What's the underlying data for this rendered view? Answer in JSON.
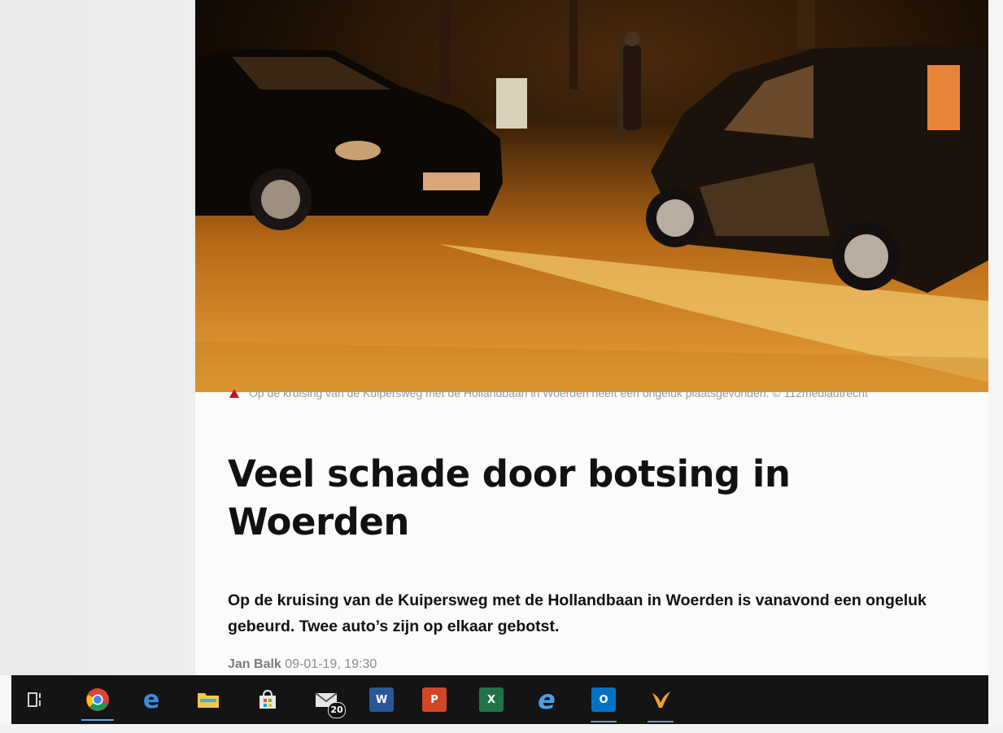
{
  "article": {
    "caption": "Op de kruising van de Kuipersweg met de Hollandbaan in Woerden heeft een ongeluk plaatsgevonden. © 112mediautrecht",
    "headline": "Veel schade door botsing in Woerden",
    "lead": "Op de kruising van de Kuipersweg met de Hollandbaan in Woerden is vanavond een ongeluk gebeurd. Twee auto’s zijn op elkaar gebotst.",
    "author": "Jan Balk",
    "timestamp": "09-01-19, 19:30"
  },
  "taskbar": {
    "items": [
      {
        "name": "task-view",
        "icon": "task-view-icon"
      },
      {
        "name": "chrome",
        "icon": "chrome-icon"
      },
      {
        "name": "edge",
        "icon": "edge-icon"
      },
      {
        "name": "file-explorer",
        "icon": "folder-icon"
      },
      {
        "name": "store",
        "icon": "store-icon"
      },
      {
        "name": "mail",
        "icon": "mail-icon",
        "badge": "20"
      },
      {
        "name": "word",
        "icon": "word-icon",
        "label": "W"
      },
      {
        "name": "powerpoint",
        "icon": "powerpoint-icon",
        "label": "P"
      },
      {
        "name": "excel",
        "icon": "excel-icon",
        "label": "X"
      },
      {
        "name": "internet-explorer",
        "icon": "ie-icon",
        "label": "e"
      },
      {
        "name": "outlook",
        "icon": "outlook-icon",
        "label": "O"
      },
      {
        "name": "app-bird",
        "icon": "bird-icon"
      }
    ]
  },
  "colors": {
    "caption_triangle": "#c0141a",
    "taskbar": "#141414",
    "chrome_accent": "#5aa9e6"
  }
}
